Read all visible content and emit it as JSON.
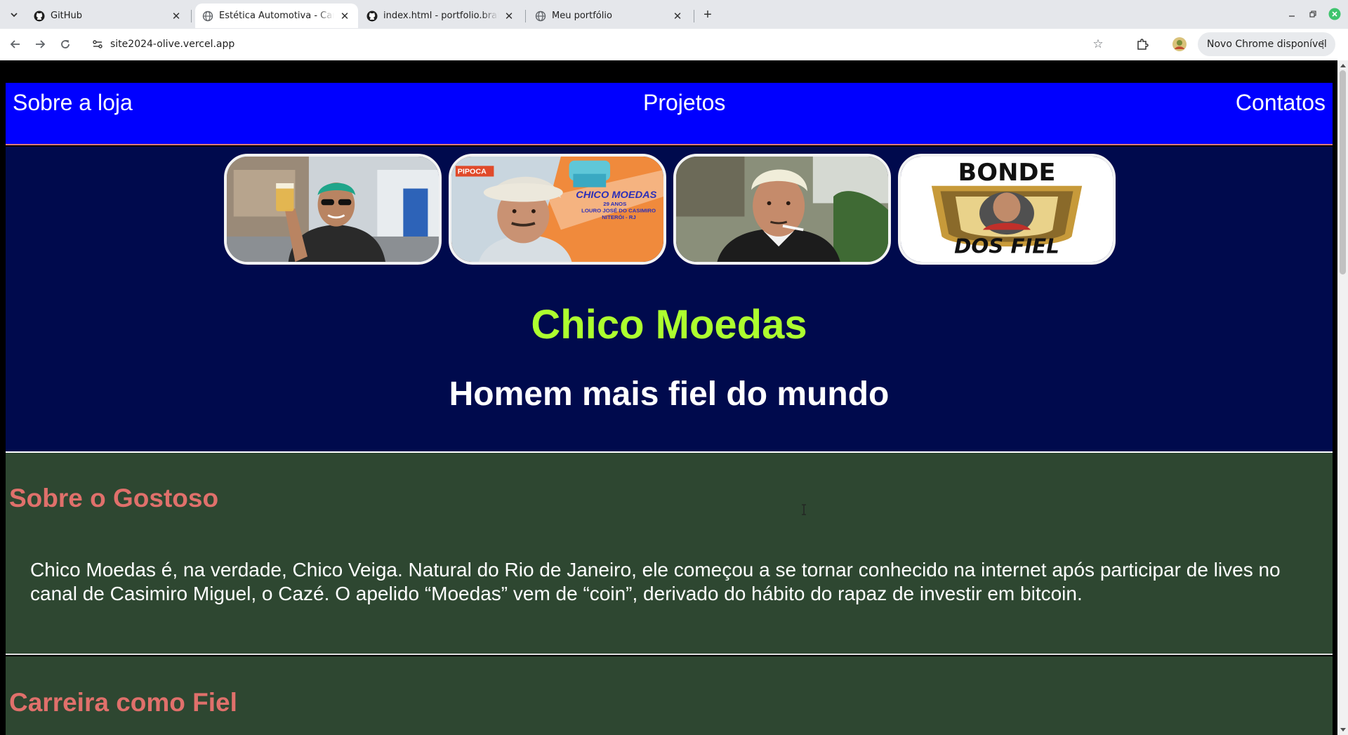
{
  "browser": {
    "tabs": [
      {
        "title": "GitHub",
        "favicon": "github-icon",
        "active": false
      },
      {
        "title": "Estética Automotiva - Camaro",
        "favicon": "globe-icon",
        "active": true
      },
      {
        "title": "index.html - portfolio.brabao",
        "favicon": "github-icon",
        "active": false
      },
      {
        "title": "Meu portfólio",
        "favicon": "globe-icon",
        "active": false
      }
    ],
    "url": "site2024-olive.vercel.app",
    "update_label": "Novo Chrome disponível",
    "close_glyph": "✕",
    "new_tab_glyph": "+"
  },
  "site": {
    "nav": {
      "about": "Sobre a loja",
      "projects": "Projetos",
      "contacts": "Contatos"
    },
    "hero": {
      "title": "Chico Moedas",
      "subtitle": "Homem mais fiel do mundo",
      "photos": [
        {
          "name": "photo-toast"
        },
        {
          "name": "photo-pipoca-poster",
          "text_lines": [
            "PIPOCA",
            "CHICO MOEDAS",
            "29 ANOS",
            "LOURO JOSÉ DO CASIMIRO",
            "NITERÓI - RJ"
          ]
        },
        {
          "name": "photo-smoking"
        },
        {
          "name": "photo-bonde-badge",
          "text_lines": [
            "BONDE",
            "DOS FIEL"
          ]
        }
      ]
    },
    "about": {
      "heading": "Sobre o Gostoso",
      "text": "Chico Moedas é, na verdade, Chico Veiga. Natural do Rio de Janeiro, ele começou a se tornar conhecido na internet após participar de lives no canal de Casimiro Miguel, o Cazé. O apelido “Moedas” vem de “coin”, derivado do hábito do rapaz de investir em bitcoin."
    },
    "career": {
      "heading": "Carreira como Fiel"
    }
  },
  "colors": {
    "nav_bg": "#0000ff",
    "hero_bg": "#000a4d",
    "section_bg": "#2e4731",
    "title_green": "#adff2f",
    "heading_salmon": "#e0706b"
  }
}
